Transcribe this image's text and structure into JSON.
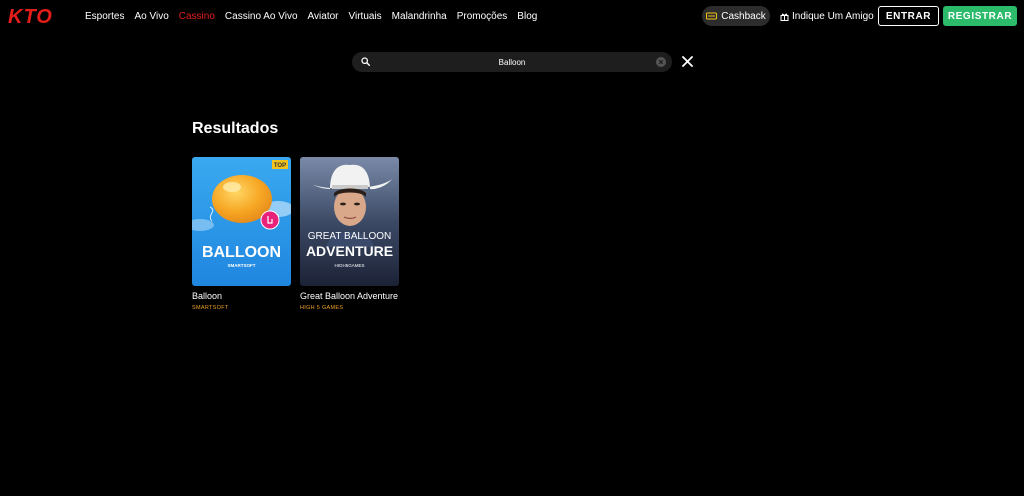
{
  "brand": {
    "logo_text": "KTO",
    "accent_color": "#e31d1a",
    "register_color": "#2bbb6b"
  },
  "nav": {
    "items": [
      {
        "label": "Esportes",
        "active": false
      },
      {
        "label": "Ao Vivo",
        "active": false
      },
      {
        "label": "Cassino",
        "active": true
      },
      {
        "label": "Cassino Ao Vivo",
        "active": false
      },
      {
        "label": "Aviator",
        "active": false
      },
      {
        "label": "Virtuais",
        "active": false
      },
      {
        "label": "Malandrinha",
        "active": false
      },
      {
        "label": "Promoções",
        "active": false
      },
      {
        "label": "Blog",
        "active": false
      }
    ]
  },
  "header": {
    "cashback_label": "Cashback",
    "refer_label": "Indique Um Amigo",
    "login_label": "ENTRAR",
    "register_label": "REGISTRAR"
  },
  "search": {
    "value": "Balloon",
    "icons": [
      "search-icon",
      "clear-icon",
      "close-icon"
    ]
  },
  "results": {
    "title": "Resultados",
    "games": [
      {
        "name": "Balloon",
        "provider": "SMARTSOFT",
        "badge": "TOP",
        "art_title": "BALLOON",
        "art_subtitle": "SMARTSOFT"
      },
      {
        "name": "Great Balloon Adventure",
        "provider": "HIGH 5 GAMES",
        "art_title_line1": "GREAT BALLOON",
        "art_title_line2": "ADVENTURE",
        "art_subtitle": "HIGH5GAMES"
      }
    ]
  }
}
